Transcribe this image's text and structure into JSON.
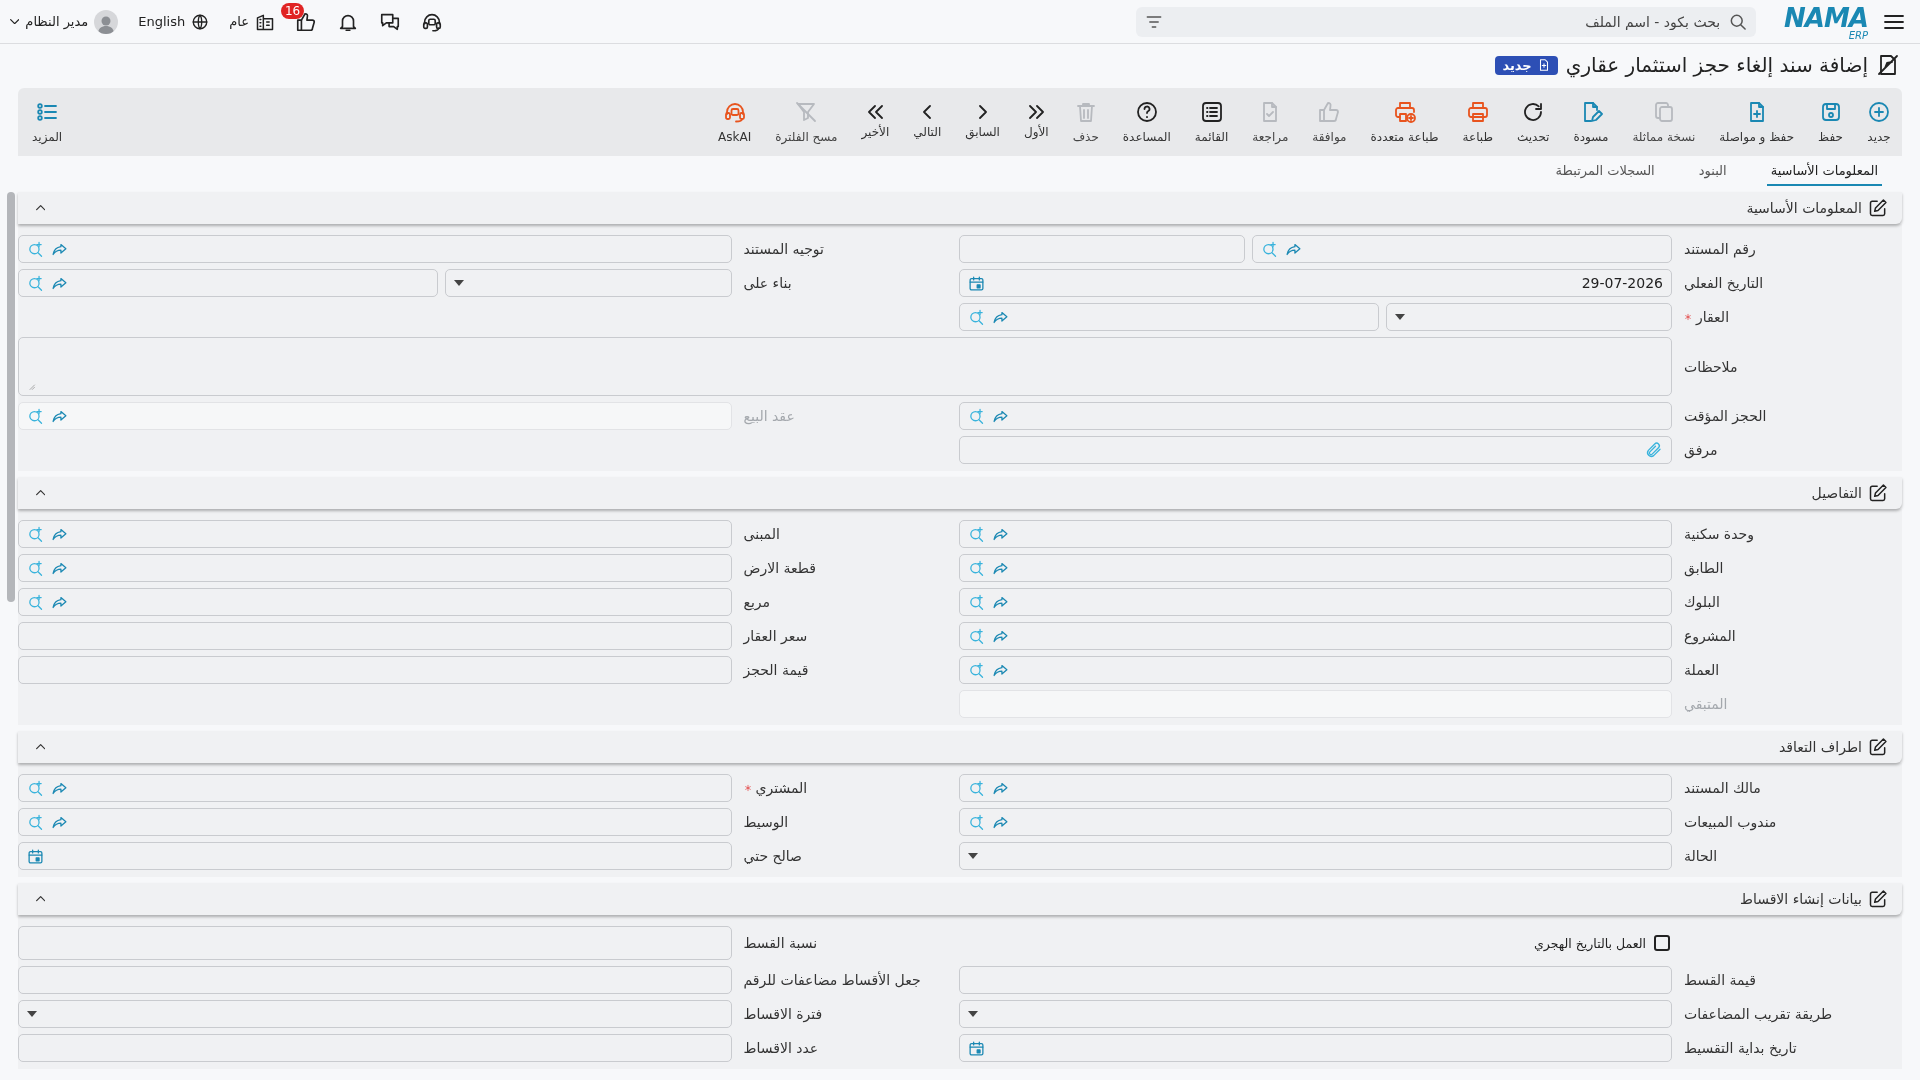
{
  "topbar": {
    "logo": {
      "text": "NAMA",
      "sub": "ERP"
    },
    "search": {
      "placeholder": "بحث بكود - اسم الملف"
    },
    "notifications_badge": "16",
    "company": "عام",
    "language": "English",
    "user": "مدير النظام"
  },
  "title": {
    "text": "إضافة سند إلغاء حجز استثمار عقاري",
    "badge": "جديد"
  },
  "toolbar": {
    "items": [
      {
        "label": "جديد",
        "kind": "new",
        "disabled": false
      },
      {
        "label": "حفظ",
        "kind": "save",
        "disabled": false
      },
      {
        "label": "حفظ و مواصلة",
        "kind": "save-continue",
        "disabled": false
      },
      {
        "label": "نسخة مماثلة",
        "kind": "duplicate",
        "disabled": true
      },
      {
        "label": "مسودة",
        "kind": "draft",
        "disabled": false
      },
      {
        "label": "تحديث",
        "kind": "refresh",
        "disabled": false
      },
      {
        "label": "طباعة",
        "kind": "print",
        "disabled": false
      },
      {
        "label": "طباعة متعددة",
        "kind": "print-multi",
        "disabled": false
      },
      {
        "label": "موافقة",
        "kind": "approve",
        "disabled": true
      },
      {
        "label": "مراجعة",
        "kind": "review",
        "disabled": true
      },
      {
        "label": "القائمة",
        "kind": "list",
        "disabled": false
      },
      {
        "label": "المساعدة",
        "kind": "help",
        "disabled": false
      },
      {
        "label": "حذف",
        "kind": "delete",
        "disabled": true
      },
      {
        "label": "الأول",
        "kind": "first",
        "disabled": false
      },
      {
        "label": "السابق",
        "kind": "prev",
        "disabled": false
      },
      {
        "label": "التالي",
        "kind": "next",
        "disabled": false
      },
      {
        "label": "الأخير",
        "kind": "last",
        "disabled": false
      },
      {
        "label": "مسح الفلترة",
        "kind": "clear-filter",
        "disabled": true
      },
      {
        "label": "AskAI",
        "kind": "ask-ai",
        "disabled": false
      },
      {
        "label": "المزيد",
        "kind": "more",
        "disabled": false
      }
    ]
  },
  "tabs": [
    {
      "label": "المعلومات الأساسية",
      "selected": true
    },
    {
      "label": "البنود",
      "selected": false
    },
    {
      "label": "السجلات المرتبطة",
      "selected": false
    }
  ],
  "sections": [
    {
      "title": "المعلومات الأساسية",
      "expanded": true,
      "rows": [
        [
          {
            "label": "رقم المستند",
            "kind": "number-lookup",
            "required": false,
            "disabled": false
          },
          {
            "label": "توجيه المستند",
            "kind": "lookup",
            "required": false,
            "disabled": false
          }
        ],
        [
          {
            "label": "التاريخ الفعلي",
            "kind": "date",
            "value": "29-07-2026",
            "required": false,
            "disabled": false
          },
          {
            "label": "بناء على",
            "kind": "select-lookup",
            "required": false,
            "disabled": false
          }
        ],
        [
          {
            "label": "العقار",
            "kind": "select-lookup",
            "required": true,
            "disabled": false
          }
        ],
        [
          {
            "label": "ملاحظات",
            "kind": "textarea",
            "required": false,
            "disabled": false
          }
        ],
        [
          {
            "label": "الحجز المؤقت",
            "kind": "lookup",
            "required": false,
            "disabled": false
          },
          {
            "label": "عقد البيع",
            "kind": "lookup",
            "required": false,
            "disabled": true
          }
        ],
        [
          {
            "label": "مرفق",
            "kind": "attachment",
            "required": false,
            "disabled": false
          }
        ]
      ]
    },
    {
      "title": "التفاصيل",
      "expanded": true,
      "rows": [
        [
          {
            "label": "وحدة سكنية",
            "kind": "lookup",
            "required": false,
            "disabled": false
          },
          {
            "label": "المبنى",
            "kind": "lookup",
            "required": false,
            "disabled": false
          }
        ],
        [
          {
            "label": "الطابق",
            "kind": "lookup",
            "required": false,
            "disabled": false
          },
          {
            "label": "قطعة الارض",
            "kind": "lookup",
            "required": false,
            "disabled": false
          }
        ],
        [
          {
            "label": "البلوك",
            "kind": "lookup",
            "required": false,
            "disabled": false
          },
          {
            "label": "مربع",
            "kind": "lookup",
            "required": false,
            "disabled": false
          }
        ],
        [
          {
            "label": "المشروع",
            "kind": "lookup",
            "required": false,
            "disabled": false
          },
          {
            "label": "سعر العقار",
            "kind": "text",
            "required": false,
            "disabled": false
          }
        ],
        [
          {
            "label": "العملة",
            "kind": "lookup",
            "required": false,
            "disabled": false
          },
          {
            "label": "قيمة الحجز",
            "kind": "text",
            "required": false,
            "disabled": false
          }
        ],
        [
          {
            "label": "المتبقي",
            "kind": "text",
            "required": false,
            "disabled": true
          }
        ]
      ]
    },
    {
      "title": "اطراف التعاقد",
      "expanded": true,
      "rows": [
        [
          {
            "label": "مالك المستند",
            "kind": "lookup",
            "required": false,
            "disabled": false
          },
          {
            "label": "المشتري",
            "kind": "lookup",
            "required": true,
            "disabled": false
          }
        ],
        [
          {
            "label": "مندوب المبيعات",
            "kind": "lookup",
            "required": false,
            "disabled": false
          },
          {
            "label": "الوسيط",
            "kind": "lookup",
            "required": false,
            "disabled": false
          }
        ],
        [
          {
            "label": "الحالة",
            "kind": "select",
            "required": false,
            "disabled": false
          },
          {
            "label": "صالح حتي",
            "kind": "date",
            "required": false,
            "disabled": false
          }
        ]
      ]
    },
    {
      "title": "بيانات إنشاء الاقساط",
      "expanded": true,
      "rows": [
        [
          {
            "label": "العمل بالتاريخ الهجري",
            "kind": "checkbox",
            "checked": false
          },
          {
            "label": "نسبة القسط",
            "kind": "text",
            "required": false,
            "disabled": false
          }
        ],
        [
          {
            "label": "قيمة القسط",
            "kind": "text",
            "required": false,
            "disabled": false
          },
          {
            "label": "جعل الأقساط مضاعفات للرقم",
            "kind": "text",
            "required": false,
            "disabled": false
          }
        ],
        [
          {
            "label": "طريقة تقريب المضاعفات",
            "kind": "select",
            "required": false,
            "disabled": false
          },
          {
            "label": "فترة الاقساط",
            "kind": "select",
            "required": false,
            "disabled": false
          }
        ],
        [
          {
            "label": "تاريخ بداية التقسيط",
            "kind": "date",
            "required": false,
            "disabled": false
          },
          {
            "label": "عدد الاقساط",
            "kind": "text",
            "required": false,
            "disabled": false
          }
        ]
      ]
    }
  ]
}
